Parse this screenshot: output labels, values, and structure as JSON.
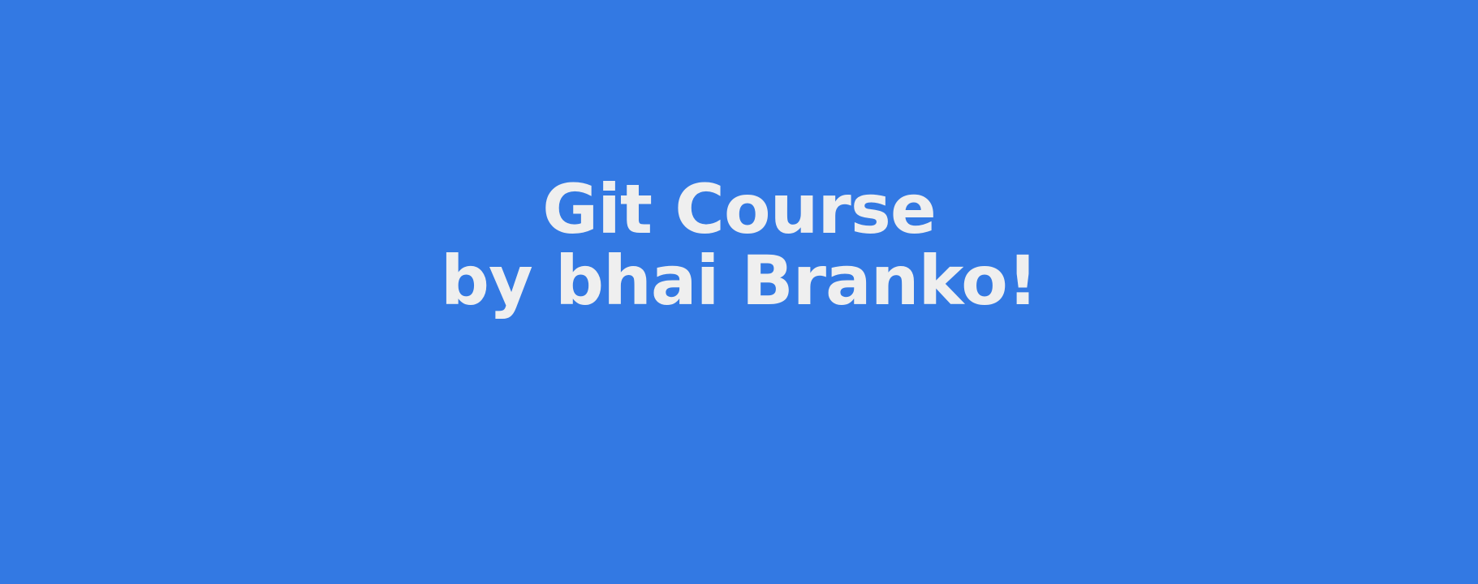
{
  "banner": {
    "background_color": "#3379e3",
    "text_color": "#efefef",
    "title_line_1": "Git Course",
    "title_line_2": "by bhai Branko!"
  }
}
